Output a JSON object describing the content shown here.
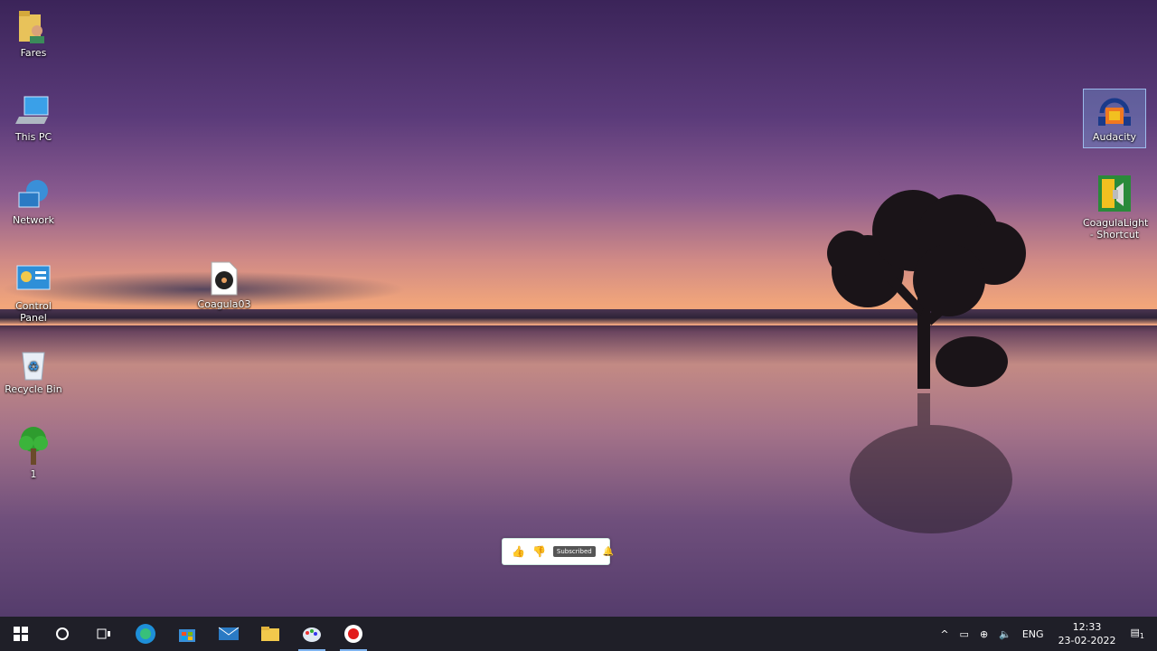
{
  "desktop": {
    "icons_left": [
      {
        "label": "Fares",
        "icon": "user-folder-icon"
      },
      {
        "label": "This PC",
        "icon": "computer-icon"
      },
      {
        "label": "Network",
        "icon": "network-icon"
      },
      {
        "label": "Control Panel",
        "icon": "control-panel-icon"
      },
      {
        "label": "Recycle Bin",
        "icon": "recycle-bin-icon"
      },
      {
        "label": "1",
        "icon": "tree-icon"
      }
    ],
    "file_icon": {
      "label": "Coagula03",
      "icon": "audio-file-icon"
    },
    "icons_right": [
      {
        "label": "Audacity",
        "icon": "audacity-icon"
      },
      {
        "label": "CoagulaLight - Shortcut",
        "icon": "coagula-icon"
      }
    ]
  },
  "widget": {
    "subscribed_label": "Subscribed"
  },
  "taskbar": {
    "apps": [
      "windows-start-icon",
      "cortana-icon",
      "task-view-icon",
      "edge-icon",
      "store-icon",
      "mail-icon",
      "file-explorer-icon",
      "paint-icon",
      "record-icon"
    ],
    "tray": {
      "language": "ENG",
      "time": "12:33",
      "date": "23-02-2022",
      "notifications": "1"
    }
  },
  "colors": {
    "taskbar": "#1f1f28",
    "accent": "#7fb4f0"
  }
}
